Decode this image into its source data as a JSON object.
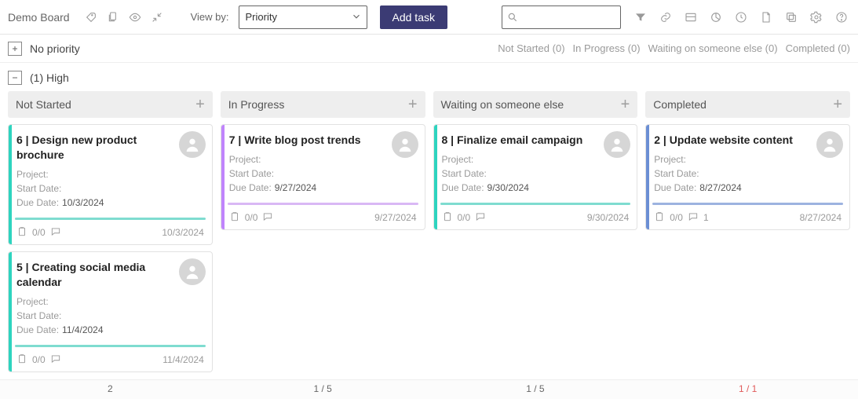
{
  "header": {
    "board_title": "Demo Board",
    "view_by_label": "View by:",
    "view_by_value": "Priority",
    "add_task_label": "Add task"
  },
  "groups": [
    {
      "name": "No priority",
      "collapsed": true,
      "status_counts": [
        {
          "label": "Not Started",
          "count": 0
        },
        {
          "label": "In Progress",
          "count": 0
        },
        {
          "label": "Waiting on someone else",
          "count": 0
        },
        {
          "label": "Completed",
          "count": 0
        }
      ]
    },
    {
      "name": "High",
      "count_prefix": "(1)",
      "collapsed": false
    }
  ],
  "columns": [
    {
      "title": "Not Started",
      "footer": "2",
      "cards": [
        {
          "title": "6 | Design new product brochure",
          "project_label": "Project:",
          "project_value": "",
          "start_label": "Start Date:",
          "start_value": "",
          "due_label": "Due Date:",
          "due_value": "10/3/2024",
          "subtasks": "0/0",
          "comments": "",
          "footer_date": "10/3/2024",
          "accent": "teal"
        },
        {
          "title": "5 | Creating social media calendar",
          "project_label": "Project:",
          "project_value": "",
          "start_label": "Start Date:",
          "start_value": "",
          "due_label": "Due Date:",
          "due_value": "11/4/2024",
          "subtasks": "0/0",
          "comments": "",
          "footer_date": "11/4/2024",
          "accent": "teal"
        }
      ]
    },
    {
      "title": "In Progress",
      "footer": "1  /  5",
      "cards": [
        {
          "title": "7 | Write blog post trends",
          "project_label": "Project:",
          "project_value": "",
          "start_label": "Start Date:",
          "start_value": "",
          "due_label": "Due Date:",
          "due_value": "9/27/2024",
          "subtasks": "0/0",
          "comments": "",
          "footer_date": "9/27/2024",
          "accent": "purple"
        }
      ]
    },
    {
      "title": "Waiting on someone else",
      "footer": "1  /  5",
      "cards": [
        {
          "title": "8 | Finalize email campaign",
          "project_label": "Project:",
          "project_value": "",
          "start_label": "Start Date:",
          "start_value": "",
          "due_label": "Due Date:",
          "due_value": "9/30/2024",
          "subtasks": "0/0",
          "comments": "",
          "footer_date": "9/30/2024",
          "accent": "teal"
        }
      ]
    },
    {
      "title": "Completed",
      "footer": "1  /  1",
      "footer_red": true,
      "cards": [
        {
          "title": "2 | Update website content",
          "project_label": "Project:",
          "project_value": "",
          "start_label": "Start Date:",
          "start_value": "",
          "due_label": "Due Date:",
          "due_value": "8/27/2024",
          "subtasks": "0/0",
          "comments": "1",
          "footer_date": "8/27/2024",
          "accent": "blue"
        }
      ]
    }
  ]
}
